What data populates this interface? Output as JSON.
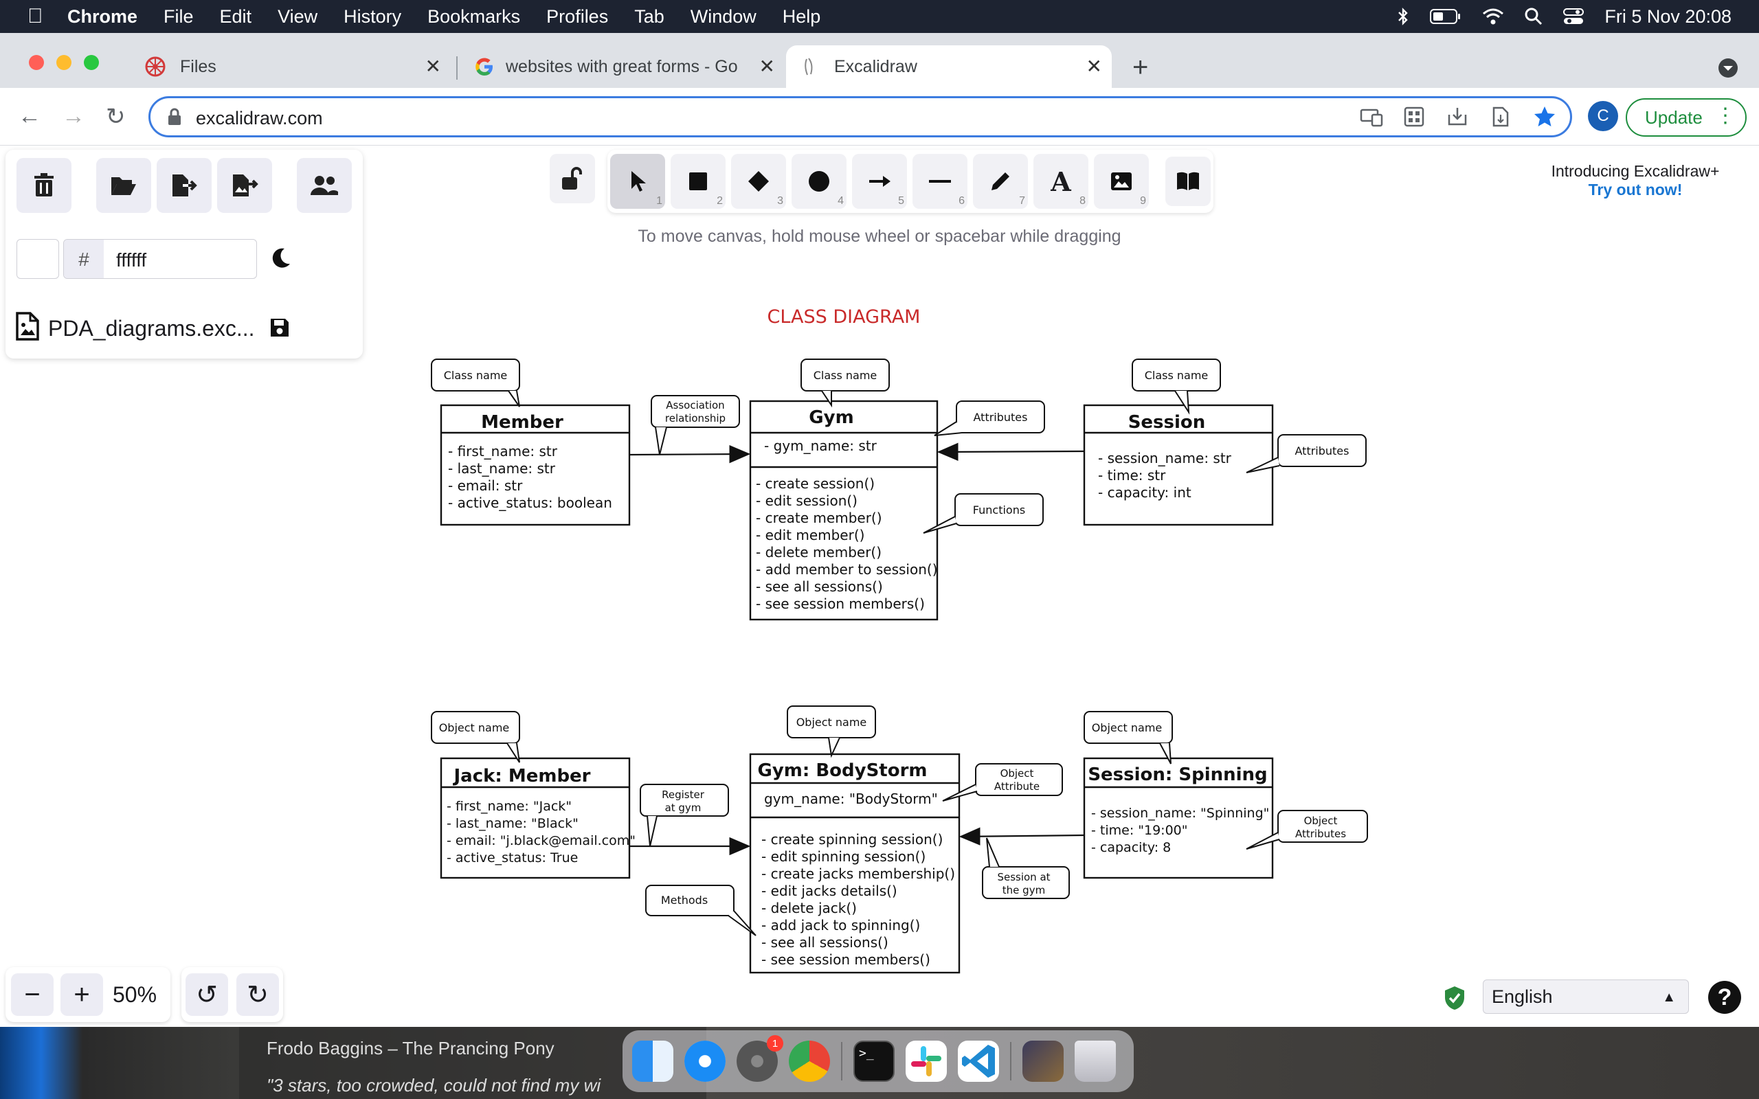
{
  "menubar": {
    "app_name": "Chrome",
    "menus": [
      "File",
      "Edit",
      "View",
      "History",
      "Bookmarks",
      "Profiles",
      "Tab",
      "Window",
      "Help"
    ],
    "clock": "Fri 5 Nov  20:08"
  },
  "tabs": [
    {
      "title": "Files"
    },
    {
      "title": "websites with great forms - Go"
    },
    {
      "title": "Excalidraw"
    }
  ],
  "address_bar": {
    "url": "excalidraw.com"
  },
  "browser": {
    "update_label": "Update",
    "profile_initial": "C"
  },
  "excalidraw": {
    "background_hash": "#",
    "background_value": "ffffff",
    "file_name": "PDA_diagrams.exc...",
    "hint": "To move canvas, hold mouse wheel or spacebar while dragging",
    "promo_title": "Introducing Excalidraw+",
    "promo_link": "Try out now!",
    "zoom": "50%",
    "language": "English",
    "help": "?",
    "tool_numbers": [
      "1",
      "2",
      "3",
      "4",
      "5",
      "6",
      "7",
      "8",
      "9"
    ]
  },
  "diagram": {
    "title": "CLASS DIAGRAM",
    "member": {
      "name": "Member",
      "attrs": [
        "- first_name: str",
        "- last_name: str",
        "- email: str",
        "- active_status: boolean"
      ]
    },
    "gym": {
      "name": "Gym",
      "attrs": [
        "- gym_name: str"
      ],
      "methods": [
        "- create session()",
        "- edit session()",
        "- create member()",
        "- edit member()",
        "- delete member()",
        "- add member to session()",
        "- see all sessions()",
        "- see session members()"
      ]
    },
    "session": {
      "name": "Session",
      "attrs": [
        "- session_name: str",
        "- time: str",
        "- capacity: int"
      ]
    },
    "jack": {
      "name": "Jack: Member",
      "attrs": [
        "- first_name: \"Jack\"",
        "- last_name: \"Black\"",
        "- email: \"j.black@email.com\"",
        "- active_status: True"
      ]
    },
    "bodystorm": {
      "name": "Gym: BodyStorm",
      "attrs": [
        "gym_name: \"BodyStorm\""
      ],
      "methods": [
        "- create spinning session()",
        "- edit spinning session()",
        "- create jacks membership()",
        "- edit jacks details()",
        "- delete jack()",
        "- add jack to spinning()",
        "- see all sessions()",
        "- see session members()"
      ]
    },
    "spinning": {
      "name": "Session: Spinning",
      "attrs": [
        "- session_name: \"Spinning\"",
        "- time: \"19:00\"",
        "- capacity: 8"
      ]
    },
    "callouts": {
      "class_name": "Class name",
      "association": [
        "Association",
        "relationship"
      ],
      "attributes": "Attributes",
      "functions": "Functions",
      "object_name": "Object name",
      "register": [
        "Register",
        "at gym"
      ],
      "object_attribute": [
        "Object",
        "Attribute"
      ],
      "object_attributes": [
        "Object",
        "Attributes"
      ],
      "methods": "Methods",
      "session_at_gym": [
        "Session at",
        "the gym"
      ]
    }
  },
  "desktop": {
    "now_playing": "Frodo Baggins – The Prancing Pony",
    "quote": "\"3 stars, too crowded, could not find my wi",
    "dock_badge": "1"
  }
}
